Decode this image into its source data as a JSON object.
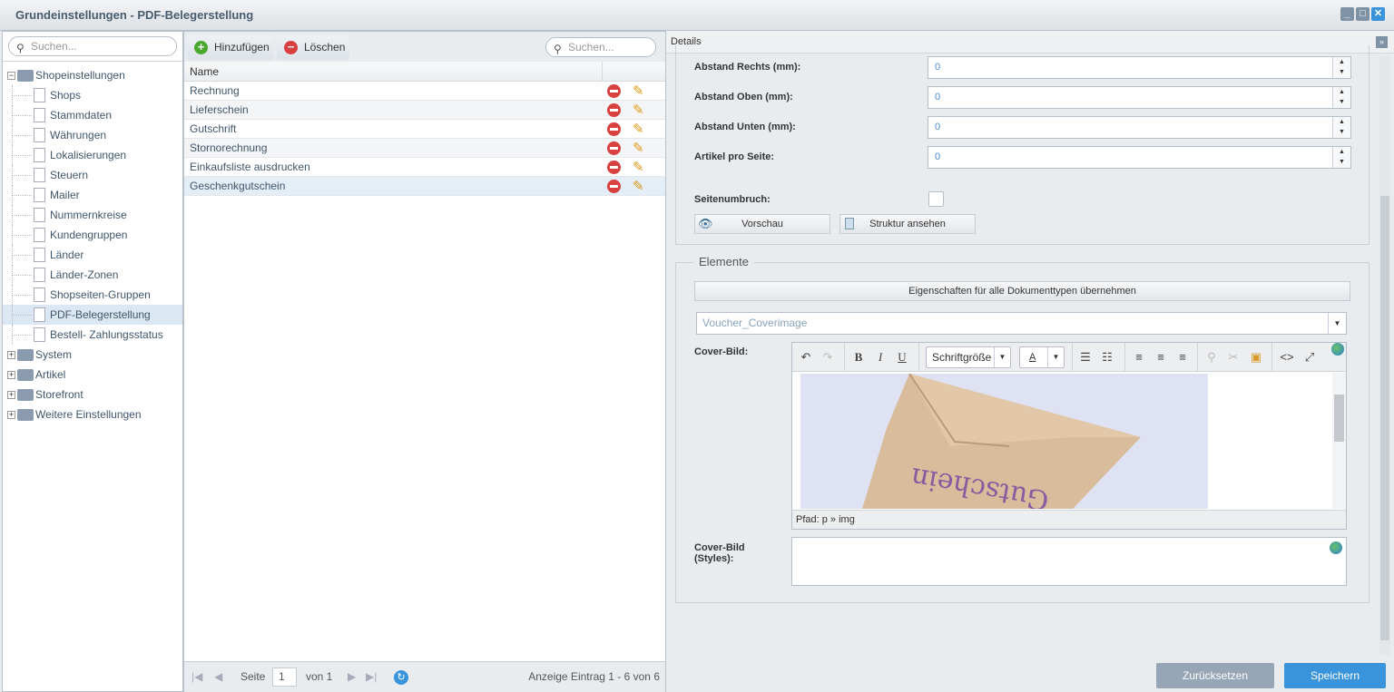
{
  "window": {
    "title": "Grundeinstellungen - PDF-Belegerstellung",
    "buttons": [
      "minimize",
      "maximize",
      "close"
    ]
  },
  "tree": {
    "search_placeholder": "Suchen...",
    "root": "Shopeinstellungen",
    "children": [
      "Shops",
      "Stammdaten",
      "Währungen",
      "Lokalisierungen",
      "Steuern",
      "Mailer",
      "Nummernkreise",
      "Kundengruppen",
      "Länder",
      "Länder-Zonen",
      "Shopseiten-Gruppen",
      "PDF-Belegerstellung",
      "Bestell- Zahlungsstatus"
    ],
    "selected": "PDF-Belegerstellung",
    "folders": [
      "System",
      "Artikel",
      "Storefront",
      "Weitere Einstellungen"
    ]
  },
  "grid": {
    "add_label": "Hinzufügen",
    "delete_label": "Löschen",
    "search_placeholder": "Suchen...",
    "column_name": "Name",
    "rows": [
      "Rechnung",
      "Lieferschein",
      "Gutschrift",
      "Stornorechnung",
      "Einkaufsliste ausdrucken",
      "Geschenkgutschein"
    ],
    "selected": "Geschenkgutschein",
    "pager": {
      "page_label": "Seite",
      "page": "1",
      "of_label": "von 1",
      "summary": "Anzeige Eintrag 1 - 6 von 6"
    }
  },
  "details": {
    "title": "Details",
    "fields": [
      {
        "label": "Abstand Rechts (mm):",
        "value": "0"
      },
      {
        "label": "Abstand Oben (mm):",
        "value": "0"
      },
      {
        "label": "Abstand Unten (mm):",
        "value": "0"
      },
      {
        "label": "Artikel pro Seite:",
        "value": "0"
      }
    ],
    "pagebreak_label": "Seitenumbruch:",
    "pagebreak_checked": false,
    "preview_label": "Vorschau",
    "structure_label": "Struktur ansehen",
    "elements_legend": "Elemente",
    "apply_all_label": "Eigenschaften für alle Dokumenttypen übernehmen",
    "element_select": "Voucher_Coverimage",
    "cover_label": "Cover-Bild:",
    "font_size_placeholder": "Schriftgröße",
    "path_text": "Pfad: p » img",
    "image_text": "Gutschein",
    "cover_styles_label": "Cover-Bild (Styles):",
    "reset_label": "Zurücksetzen",
    "save_label": "Speichern"
  },
  "colors": {
    "accent": "#3a94dc",
    "save": "#3a94dc",
    "reset": "#97a6b6"
  }
}
